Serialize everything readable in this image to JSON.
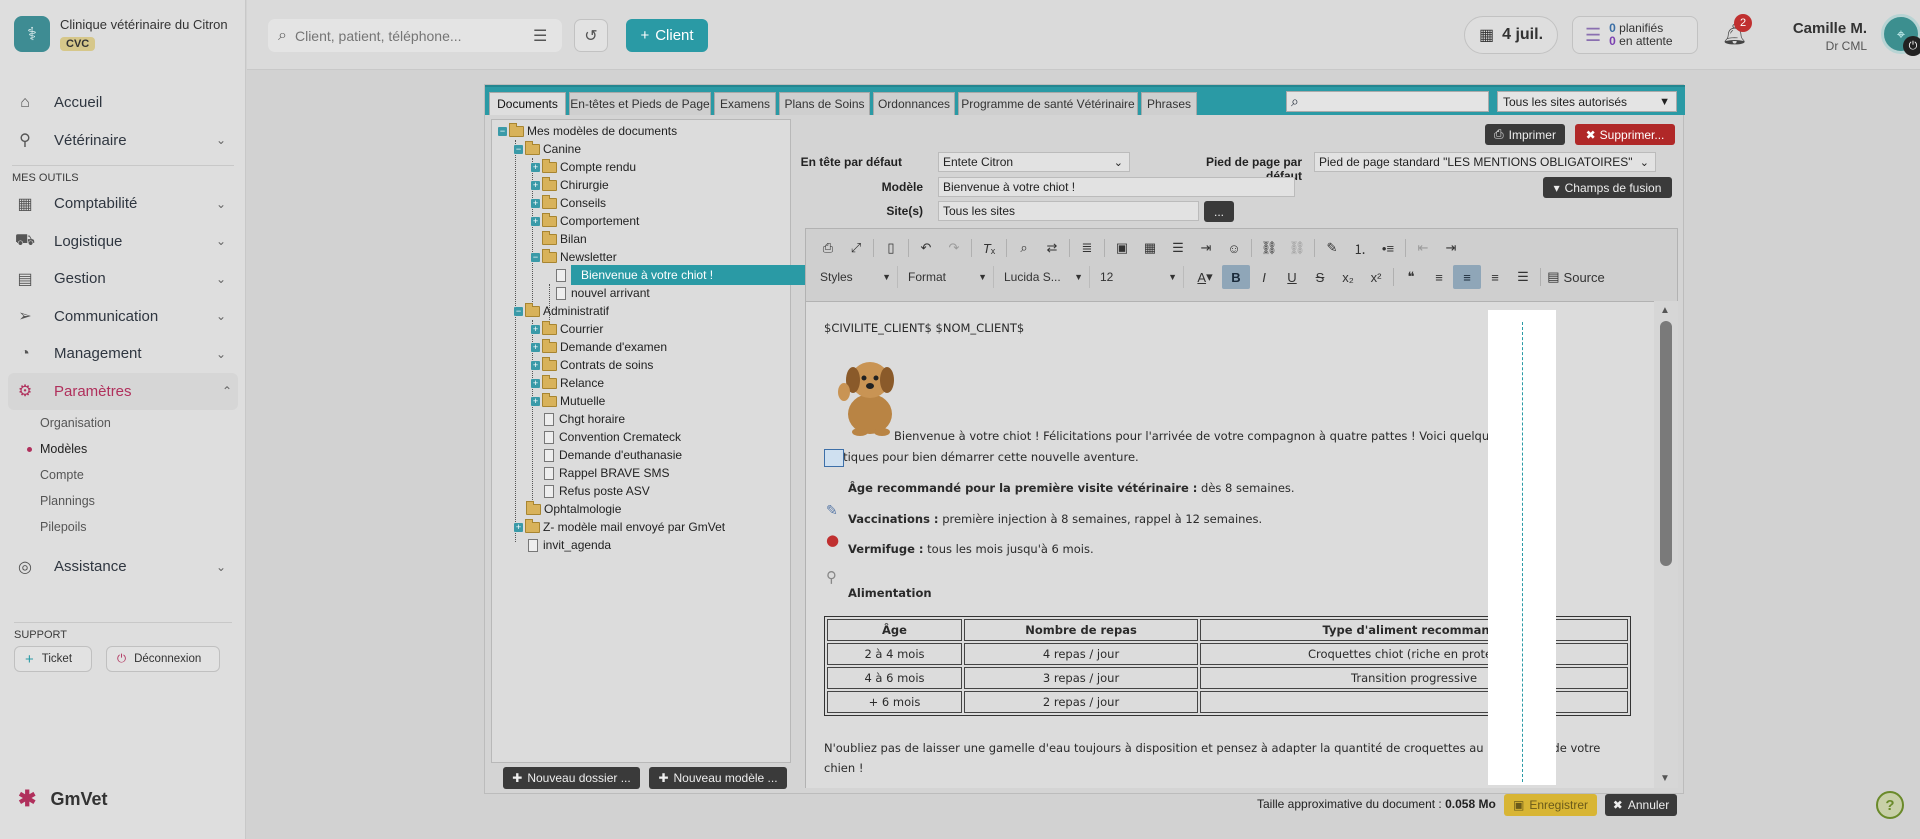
{
  "sidebar": {
    "clinic_name": "Clinique vétérinaire du Citron",
    "clinic_badge": "CVC",
    "nav": [
      {
        "label": "Accueil",
        "icon": "home-icon"
      },
      {
        "label": "Vétérinaire",
        "icon": "stethoscope-icon"
      }
    ],
    "section_tools": "MES OUTILS",
    "tools": [
      {
        "label": "Comptabilité"
      },
      {
        "label": "Logistique"
      },
      {
        "label": "Gestion"
      },
      {
        "label": "Communication"
      },
      {
        "label": "Management"
      },
      {
        "label": "Paramètres"
      }
    ],
    "settings_sub": [
      "Organisation",
      "Modèles",
      "Compte",
      "Plannings",
      "Pilepoils"
    ],
    "assistance": "Assistance",
    "support_title": "SUPPORT",
    "ticket_label": "Ticket",
    "logout_label": "Déconnexion",
    "product_name": "GmVet"
  },
  "topbar": {
    "search_placeholder": "Client, patient, téléphone...",
    "client_button": "Client",
    "date": "4 juil.",
    "planned_count": "0",
    "planned_label": "planifiés",
    "waiting_count": "0",
    "waiting_label": "en attente",
    "notif_count": "2",
    "user_name": "Camille M.",
    "user_role": "Dr CML"
  },
  "tabs": [
    "Documents",
    "En-têtes et Pieds de Page",
    "Examens",
    "Plans de Soins",
    "Ordonnances",
    "Programme de santé Vétérinaire",
    "Phrases"
  ],
  "site_filter": "Tous les sites autorisés",
  "tree": {
    "root": "Mes modèles de documents",
    "canine": "Canine",
    "canine_children": [
      "Compte rendu",
      "Chirurgie",
      "Conseils",
      "Comportement",
      "Bilan",
      "Newsletter"
    ],
    "newsletter_children": [
      "Bienvenue à votre chiot !",
      "nouvel arrivant"
    ],
    "admin": "Administratif",
    "admin_folders": [
      "Courrier",
      "Demande d'examen",
      "Contrats de soins",
      "Relance",
      "Mutuelle"
    ],
    "admin_docs": [
      "Chgt horaire",
      "Convention Cremateck",
      "Demande d'euthanasie",
      "Rappel BRAVE SMS",
      "Refus poste ASV"
    ],
    "root_others": [
      "Ophtalmologie",
      "Z- modèle mail envoyé par GmVet"
    ],
    "root_doc": "invit_agenda",
    "new_folder": "Nouveau dossier ...",
    "new_model": "Nouveau modèle ..."
  },
  "form": {
    "print": "Imprimer",
    "delete": "Supprimer...",
    "header_label": "En tête par défaut",
    "header_value": "Entete Citron",
    "footer_label": "Pied de page par défaut",
    "footer_value": "Pied de page standard \"LES MENTIONS OBLIGATOIRES\"",
    "model_label": "Modèle",
    "model_value": "Bienvenue à votre chiot !",
    "sites_label": "Site(s)",
    "sites_value": "Tous les sites",
    "sites_more": "...",
    "merge_fields": "Champs de fusion"
  },
  "toolbar": {
    "styles": "Styles",
    "format": "Format",
    "font": "Lucida S...",
    "size": "12",
    "source": "Source"
  },
  "doc": {
    "salutation": "$CIVILITE_CLIENT$ $NOM_CLIENT$",
    "intro_1": "Bienvenue à votre chiot ! Félicitations pour l'arrivée de votre compagnon à quatre pattes ! Voici quelques conseils",
    "intro_2": "pratiques pour bien démarrer cette nouvelle aventure.",
    "age_bold": "Âge recommandé pour la première visite vétérinaire :",
    "age_rest": "dès 8 semaines.",
    "vacc_bold": "Vaccinations :",
    "vacc_rest": "première injection à 8 semaines, rappel à 12 semaines.",
    "verm_bold": "Vermifuge :",
    "verm_rest": "tous les mois jusqu'à 6 mois.",
    "food_title": "Alimentation",
    "table_headers": [
      "Âge",
      "Nombre de repas",
      "Type d'aliment recommandé"
    ],
    "table_rows": [
      [
        "2 à 4 mois",
        "4 repas / jour",
        "Croquettes chiot (riche en protéines)"
      ],
      [
        "4 à 6 mois",
        "3 repas / jour",
        "Transition progressive"
      ],
      [
        "+ 6 mois",
        "2 repas / jour",
        ""
      ]
    ],
    "outro_1": "N'oubliez pas de laisser une gamelle d'eau toujours à disposition et pensez à adapter la quantité de croquettes au poids cible de votre",
    "outro_2": "chien !"
  },
  "footer": {
    "size_label": "Taille approximative du document :",
    "size_value": "0.058 Mo",
    "save": "Enregistrer",
    "cancel": "Annuler"
  },
  "colors": {
    "accent": "#2a9aa5",
    "active_nav": "#b0305c",
    "danger": "#b02828"
  }
}
